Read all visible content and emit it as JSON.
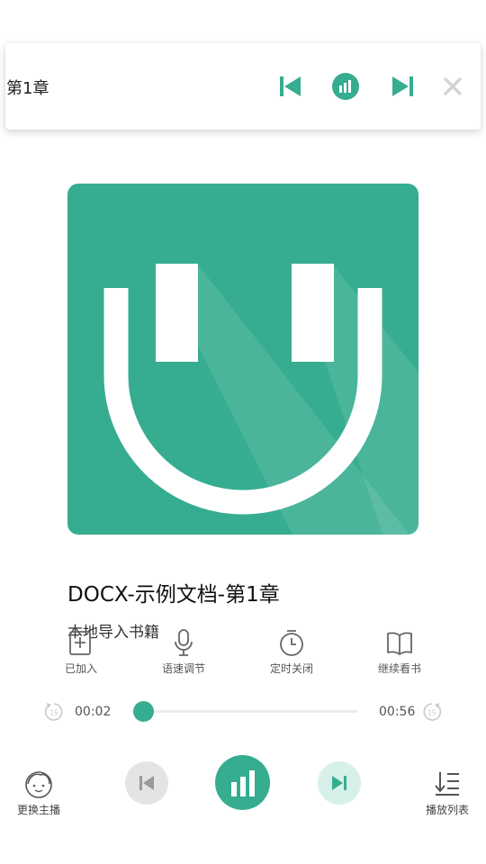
{
  "mini_player": {
    "chapter": "第1章",
    "icons": {
      "prev": "skip-previous-icon",
      "playing": "equalizer-icon",
      "next": "skip-next-icon",
      "close": "close-icon"
    }
  },
  "colors": {
    "accent": "#36ad90",
    "accent_light": "#d8f0ea",
    "disabled": "#e4e4e4",
    "icon_gray": "#666666"
  },
  "cover": {
    "logo": "headphones-logo-icon"
  },
  "book": {
    "title": "DOCX-示例文档-第1章",
    "subtitle": "本地导入书籍"
  },
  "actions": [
    {
      "label": "已加入",
      "icon": "book-added-icon"
    },
    {
      "label": "语速调节",
      "icon": "microphone-icon"
    },
    {
      "label": "定时关闭",
      "icon": "timer-icon"
    },
    {
      "label": "继续看书",
      "icon": "open-book-icon"
    }
  ],
  "progress": {
    "current": "00:02",
    "total": "00:56",
    "fraction": 0.03,
    "rewind_icon": "rewind-15-icon",
    "forward_icon": "forward-15-icon"
  },
  "bottom": {
    "change_anchor": "更换主播",
    "playlist": "播放列表",
    "icons": {
      "anchor": "anchor-avatar-icon",
      "prev": "skip-previous-icon",
      "play": "equalizer-icon",
      "next": "skip-next-icon",
      "list": "playlist-icon"
    }
  }
}
